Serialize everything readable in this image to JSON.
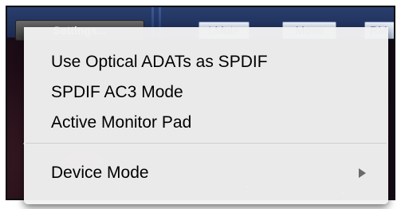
{
  "toolbar": {
    "settings_label": "Settings...",
    "buttons": [
      {
        "label": "LMute"
      },
      {
        "label": "Mono"
      },
      {
        "label": "RM"
      }
    ]
  },
  "menu": {
    "items": [
      {
        "label": "Use Optical ADATs as SPDIF"
      },
      {
        "label": "SPDIF AC3 Mode"
      },
      {
        "label": "Active Monitor Pad"
      },
      {
        "label": "Device Mode",
        "has_submenu": true,
        "submenu_icon": "chevron-right-icon"
      }
    ]
  },
  "colors": {
    "menu_background": "#f2f2f2",
    "toolbar_blue": "#1b2a52",
    "button_face": "#d6e0f0",
    "panel_dark": "#1e0c16"
  }
}
